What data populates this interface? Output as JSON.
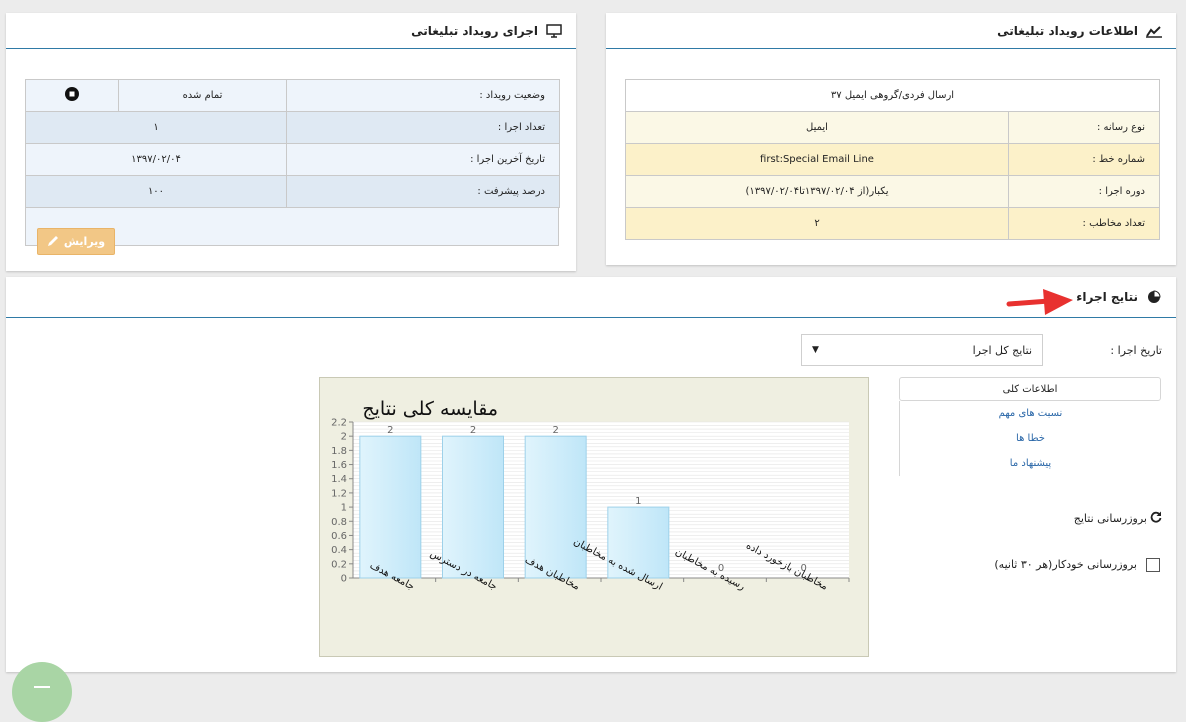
{
  "campaign_info": {
    "title": "اطلاعات رویداد تبلیغاتی",
    "icon": "line-chart-icon",
    "header_row": "ارسال فردی/گروهی ایمیل ۳۷",
    "rows": [
      {
        "label": "نوع رسانه :",
        "value": "ایمیل"
      },
      {
        "label": "شماره خط :",
        "value": "first:Special Email Line"
      },
      {
        "label": "دوره اجرا :",
        "value": "یکبار(از ۱۳۹۷/۰۲/۰۴تا۱۳۹۷/۰۲/۰۴)"
      },
      {
        "label": "تعداد مخاطب :",
        "value": "۲"
      }
    ]
  },
  "execution": {
    "title": "اجرای رویداد تبلیغاتی",
    "icon": "monitor-icon",
    "status_label": "وضعیت رویداد :",
    "status_value": "تمام شده",
    "status_icon": "stop-circle-icon",
    "rows": [
      {
        "label": "تعداد اجرا :",
        "value": "۱"
      },
      {
        "label": "تاریخ آخرین اجرا :",
        "value": "۱۳۹۷/۰۲/۰۴"
      },
      {
        "label": "درصد پیشرفت :",
        "value": "۱۰۰"
      }
    ],
    "edit_button": "ویرایش",
    "edit_icon": "pencil-icon"
  },
  "results": {
    "title": "نتایج اجراء",
    "icon": "pie-chart-icon",
    "date_label": "تاریخ اجرا :",
    "date_select": "نتایج کل اجرا",
    "tabs": {
      "active": "اطلاعات کلی",
      "links": [
        "نسبت های مهم",
        "خطا ها",
        "پیشنهاد ما"
      ]
    },
    "refresh_label": "بروزرسانی نتایج",
    "refresh_icon": "refresh-icon",
    "auto_refresh_label": "بروزرسانی خودکار(هر ۳۰ ثانیه)",
    "auto_refresh_checked": false,
    "annotation_color": "#e8312f"
  },
  "chart_data": {
    "type": "bar",
    "title": "مقایسه کلی نتایج",
    "categories": [
      "جامعه هدف",
      "جامعه در دسترس",
      "مخاطبان هدف",
      "ارسال شده به مخاطبان",
      "رسیده به مخاطبان",
      "مخاطبان بازخورد داده"
    ],
    "values": [
      2,
      2,
      2,
      1,
      0,
      0
    ],
    "data_labels": [
      "2",
      "2",
      "2",
      "1",
      "0",
      "0"
    ],
    "ylim": [
      0,
      2.2
    ],
    "yticks": [
      "0",
      "0.2",
      "0.4",
      "0.6",
      "0.8",
      "1",
      "1.2",
      "1.4",
      "1.6",
      "1.8",
      "2",
      "2.2"
    ],
    "grid": true,
    "bar_color": "#bfe6f8",
    "background": "#efefe1"
  }
}
